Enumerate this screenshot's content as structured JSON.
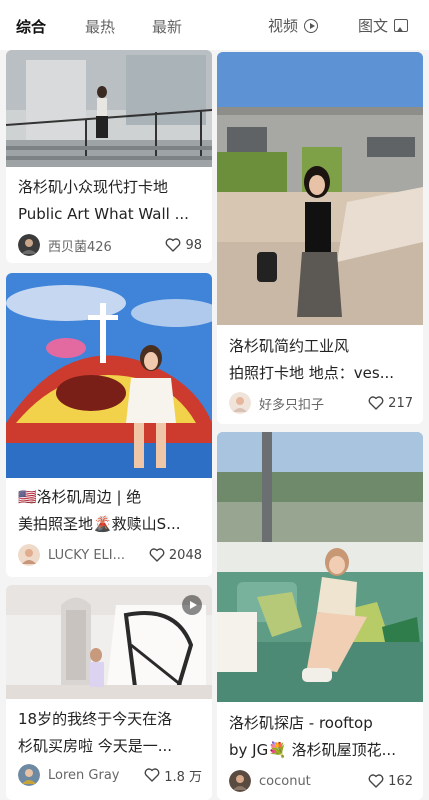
{
  "tabs": {
    "comprehensive": "综合",
    "hottest": "最热",
    "newest": "最新",
    "video": "视频",
    "image_text": "图文"
  },
  "cards": [
    {
      "title_line1": "洛杉矶小众现代打卡地",
      "title_line2": "Public Art What Wall ...",
      "author": "西贝菌426",
      "likes": "98"
    },
    {
      "title_line1": "洛杉矶简约工业风",
      "title_line2": "拍照打卡地 地点：ves...",
      "author": "好多只扣子",
      "likes": "217"
    },
    {
      "title_line1": "🇺🇸洛杉矶周边 | 绝",
      "title_line2": "美拍照圣地🌋救赎山S...",
      "author": "LUCKY ELI...",
      "likes": "2048"
    },
    {
      "title_line1": "洛杉矶探店 - rooftop",
      "title_line2": "by JG💐 洛杉矶屋顶花...",
      "author": "coconut",
      "likes": "162"
    },
    {
      "title_line1": "18岁的我终于今天在洛",
      "title_line2": "杉矶买房啦 今天是一...",
      "author": "Loren Gray",
      "likes": "1.8 万"
    }
  ],
  "icons": {
    "video_tab": "play-circle-icon",
    "image_tab": "image-icon",
    "like": "heart-outline-icon",
    "video_badge": "play-icon"
  }
}
